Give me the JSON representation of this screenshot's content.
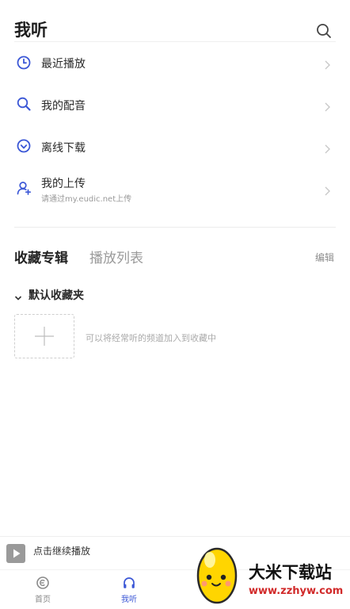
{
  "header": {
    "title": "我听",
    "search_icon": "search-icon"
  },
  "menu": [
    {
      "label": "最近播放",
      "icon": "clock-icon"
    },
    {
      "label": "我的配音",
      "icon": "magnifier-icon"
    },
    {
      "label": "离线下载",
      "icon": "download-icon"
    },
    {
      "label": "我的上传",
      "sub": "请通过my.eudic.net上传",
      "icon": "user-upload-icon"
    }
  ],
  "tabs": {
    "active": "收藏专辑",
    "inactive": "播放列表",
    "edit": "编辑"
  },
  "folder": {
    "name": "默认收藏夹",
    "hint": "可以将经常听的频道加入到收藏中"
  },
  "player": {
    "label": "点击继续播放"
  },
  "nav": [
    {
      "label": "首页",
      "icon": "home-icon"
    },
    {
      "label": "我听",
      "icon": "headphones-icon"
    }
  ],
  "watermark": {
    "title": "大米下载站",
    "url": "www.zzhyw.com"
  },
  "colors": {
    "accent": "#3b57d6",
    "nav_active": "#3b57d6",
    "nav_inactive": "#8a8a8a",
    "watermark_red": "#d12a2a"
  }
}
